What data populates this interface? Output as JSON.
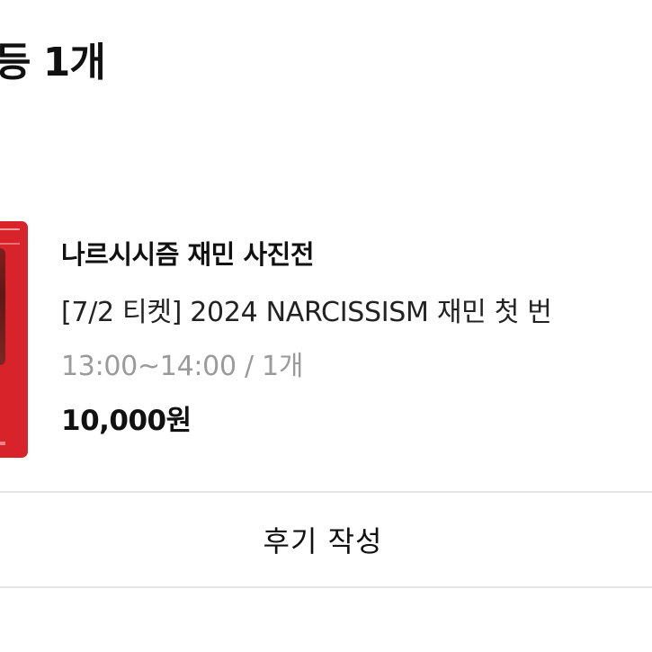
{
  "order_section": {
    "title": "등 1개"
  },
  "item": {
    "product_name": "나르시시즘 재민 사진전",
    "option_name": "[7/2 티켓] 2024 NARCISSISM 재민 첫 번",
    "time_quantity": "13:00~14:00 / 1개",
    "price": "10,000원",
    "thumbnail_color": "#d8232a"
  },
  "actions": {
    "review_label": "후기 작성"
  }
}
